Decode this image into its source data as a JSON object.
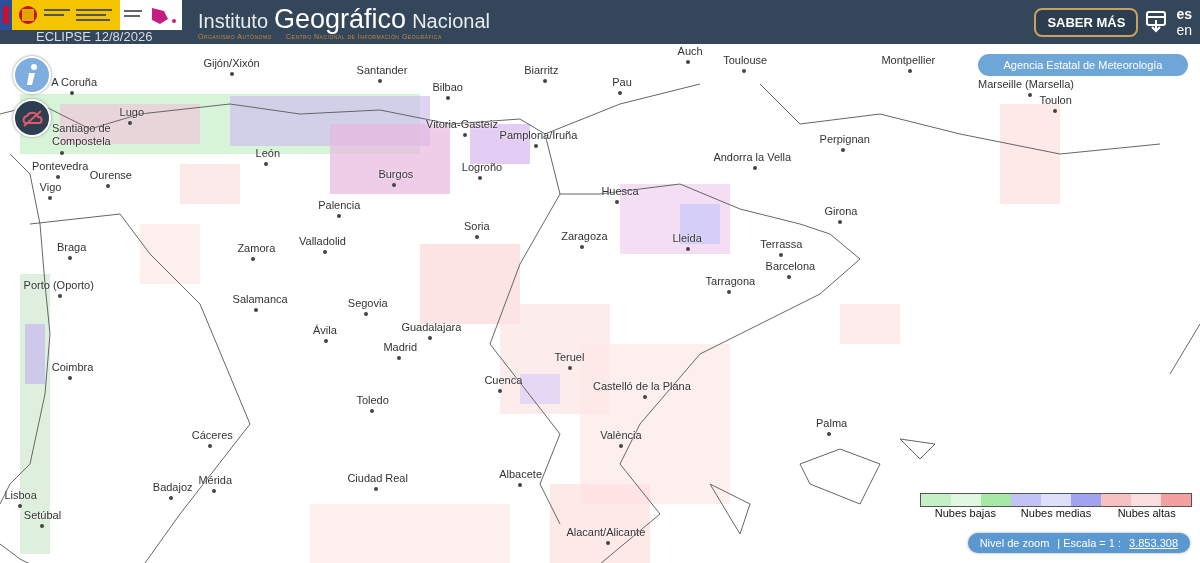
{
  "header": {
    "title_parts": [
      {
        "text": "Instituto",
        "kind": "plain"
      },
      {
        "text": "Geográfico",
        "kind": "main"
      },
      {
        "text": "Nacional",
        "kind": "plain"
      }
    ],
    "subtitle": [
      "Organismo Autónomo",
      "Centro Nacional de Información Geográfica"
    ],
    "eclipse_label": "ECLIPSE 12/8/2026",
    "more_button": "SABER MÁS",
    "languages": [
      {
        "label": "es",
        "selected": true
      },
      {
        "label": "en",
        "selected": false
      }
    ]
  },
  "map": {
    "agency_button": "Agencia Estatal de Meteorología",
    "places": [
      "Gijón/Xixón",
      "Santander",
      "Bilbao",
      "Biarritz",
      "Auch",
      "Toulouse",
      "Pau",
      "Montpellier",
      "Marseille (Marsella)",
      "Toulon",
      "A Coruña",
      "Lugo",
      "Santiago de\nCompostela",
      "Vitoria-Gasteiz",
      "Pamplona/Iruña",
      "Perpignan",
      "León",
      "Andorra la Vella",
      "Pontevedra",
      "Ourense",
      "Vigo",
      "Burgos",
      "Logroño",
      "Huesca",
      "Palencia",
      "Girona",
      "Braga",
      "Zamora",
      "Valladolid",
      "Soria",
      "Zaragoza",
      "Lleida",
      "Terrassa",
      "Barcelona",
      "Tarragona",
      "Porto (Oporto)",
      "Salamanca",
      "Segovia",
      "Guadalajara",
      "Ávila",
      "Madrid",
      "Teruel",
      "Cuenca",
      "Coimbra",
      "Castelló de la Plana",
      "Toledo",
      "Palma",
      "Cáceres",
      "València",
      "Mérida",
      "Badajoz",
      "Ciudad Real",
      "Albacete",
      "Lisboa",
      "Setúbal",
      "Alacant/Alicante"
    ]
  },
  "legend": [
    {
      "label": "Nubes bajas",
      "color": "#a6e8a6"
    },
    {
      "label": "Nubes medias",
      "color": "#a0a4f0"
    },
    {
      "label": "Nubes altas",
      "color": "#f4a0a0"
    }
  ],
  "zoom_bar": {
    "label": "Nivel de zoom",
    "scale_label": "| Escala = 1 :",
    "scale_value": "3.853.308"
  }
}
